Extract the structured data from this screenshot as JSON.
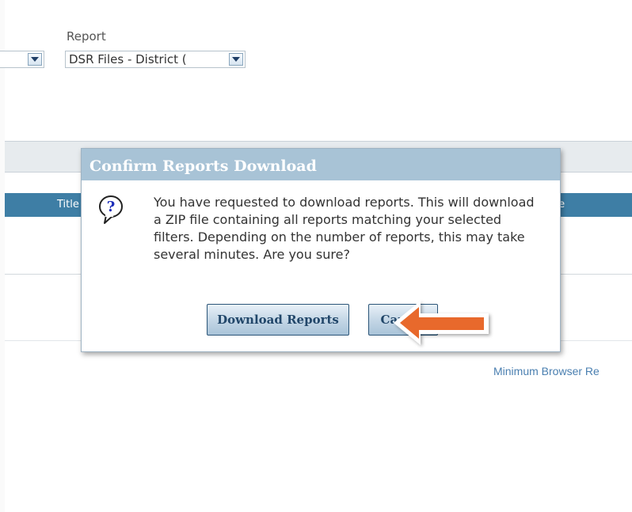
{
  "filters": {
    "report_label": "Report",
    "report_value": "DSR Files - District (",
    "prev_value": ""
  },
  "table": {
    "col_title": "Title",
    "col_date": "ate"
  },
  "dialog": {
    "title": "Confirm Reports Download",
    "message": "You have requested to download reports. This will download a ZIP file containing all reports matching your selected filters. Depending on the number of reports, this may take several minutes. Are you sure?",
    "download_button": "Download Reports",
    "cancel_button": "Cancel"
  },
  "footer": {
    "min_browser": "Minimum Browser Re"
  },
  "colors": {
    "header_blue": "#3e7ea5",
    "dialog_title_bg": "#a8c3d6",
    "arrow_orange": "#e8692c",
    "link_blue": "#4a7fb0"
  },
  "icons": {
    "dialog_icon": "question-bubble-icon",
    "dropdown_icon": "chevron-down-icon",
    "annotation": "arrow-left-icon"
  }
}
